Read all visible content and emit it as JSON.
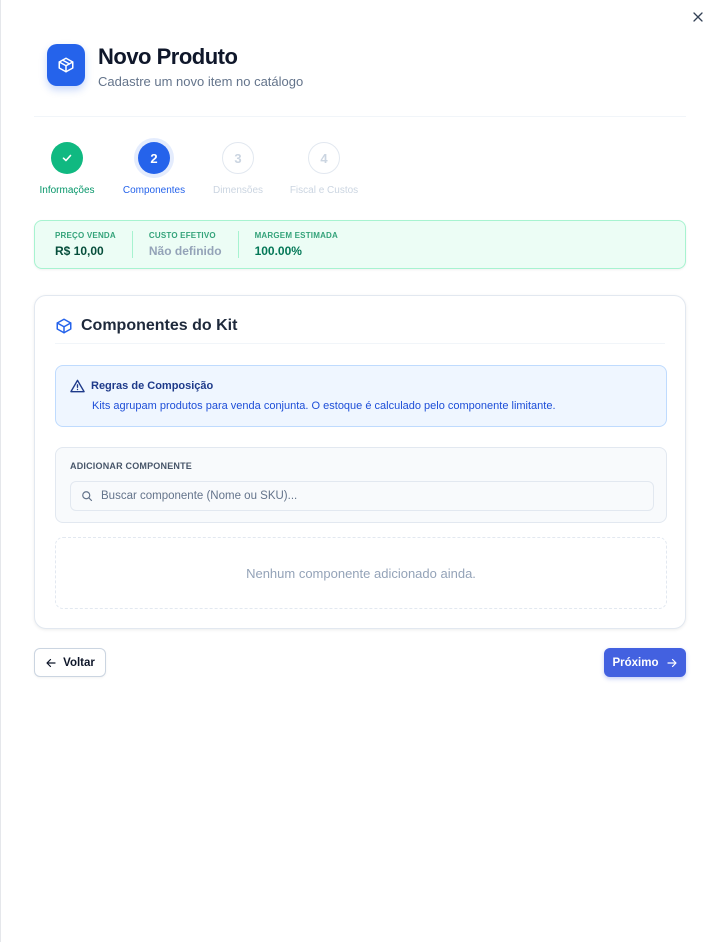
{
  "header": {
    "title": "Novo Produto",
    "subtitle": "Cadastre um novo item no catálogo",
    "icon": "package-icon"
  },
  "stepper": {
    "steps": [
      {
        "number": "1",
        "label": "Informações",
        "state": "done"
      },
      {
        "number": "2",
        "label": "Componentes",
        "state": "active"
      },
      {
        "number": "3",
        "label": "Dimensões",
        "state": "pending"
      },
      {
        "number": "4",
        "label": "Fiscal e Custos",
        "state": "pending"
      }
    ]
  },
  "summary": {
    "price_label": "PREÇO VENDA",
    "price_value": "R$ 10,00",
    "cost_label": "CUSTO EFETIVO",
    "cost_value": "Não definido",
    "margin_label": "MARGEM ESTIMADA",
    "margin_value": "100.00%"
  },
  "card": {
    "title": "Componentes do Kit",
    "alert_title": "Regras de Composição",
    "alert_text": "Kits agrupam produtos para venda conjunta. O estoque é calculado pelo componente limitante.",
    "add_label": "ADICIONAR COMPONENTE",
    "search_placeholder": "Buscar componente (Nome ou SKU)...",
    "search_value": "",
    "empty_text": "Nenhum componente adicionado ainda."
  },
  "footer": {
    "back_label": "Voltar",
    "next_label": "Próximo"
  },
  "colors": {
    "primary": "#2563eb",
    "success": "#10b981",
    "next_button": "#4361e0"
  }
}
